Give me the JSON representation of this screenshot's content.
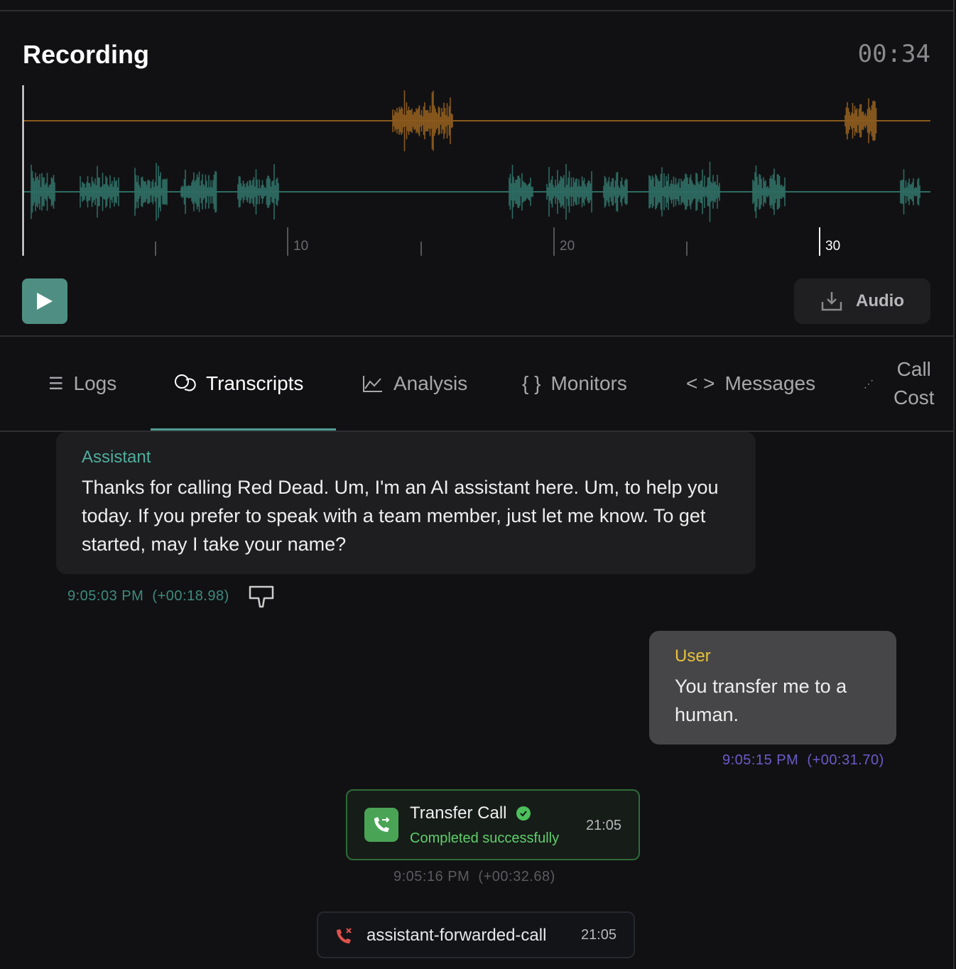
{
  "recording": {
    "title": "Recording",
    "duration": "00:34",
    "axis_labels": [
      "10",
      "20",
      "30"
    ],
    "audio_button": "Audio",
    "colors": {
      "user_wave": "#8a5a1e",
      "assistant_wave": "#2e6b62",
      "accent": "#4f8f83"
    }
  },
  "tabs": [
    {
      "label": "Logs",
      "icon": "list-icon"
    },
    {
      "label": "Transcripts",
      "icon": "chat-bubbles-icon",
      "active": true
    },
    {
      "label": "Analysis",
      "icon": "line-chart-icon"
    },
    {
      "label": "Monitors",
      "icon": "braces-icon"
    },
    {
      "label": "Messages",
      "icon": "code-icon"
    },
    {
      "label": "Call",
      "label2": "Cost",
      "icon": "scatter-icon"
    }
  ],
  "transcript": {
    "assistant": {
      "role": "Assistant",
      "text": "Thanks for calling Red Dead. Um, I'm an AI assistant here. Um, to help you today. If you prefer to speak with a team member, just let me know. To get started, may I take your name?",
      "time": "9:05:03 PM",
      "offset": "(+00:18.98)"
    },
    "user": {
      "role": "User",
      "text": "You transfer me to a human.",
      "time": "9:05:15 PM",
      "offset": "(+00:31.70)"
    },
    "tool_call": {
      "name": "Transfer Call",
      "status": "Completed successfully",
      "clock": "21:05",
      "time": "9:05:16 PM",
      "offset": "(+00:32.68)"
    },
    "ended": {
      "reason": "assistant-forwarded-call",
      "clock": "21:05"
    }
  }
}
